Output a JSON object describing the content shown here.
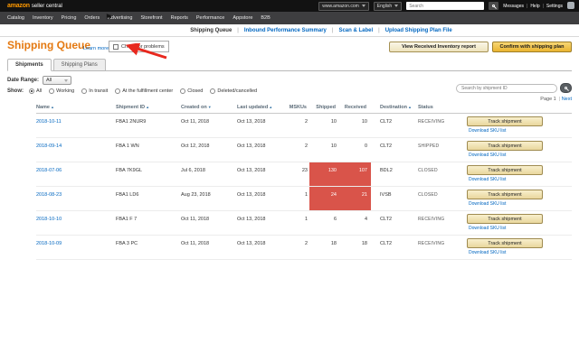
{
  "colors": {
    "title": "#e47911",
    "link": "#0066c0",
    "highlight_cell": "#d9544a",
    "primary_button_top": "#f7d675",
    "primary_button_bottom": "#eab430",
    "annotation_arrow": "#e8281e"
  },
  "icons": {
    "topbar_search": "search-icon",
    "marketplace_caret": "chevron-down-icon",
    "language_caret": "chevron-down-icon",
    "nav_flag": "flag-icon",
    "go_button": "search-icon"
  },
  "topbar": {
    "logo_brand": "amazon",
    "logo_suffix": "seller central",
    "marketplace": "www.amazon.com",
    "language": "English",
    "search_placeholder": "Search",
    "links": [
      "Messages",
      "Help",
      "Settings"
    ]
  },
  "navbar": {
    "items": [
      "Catalog",
      "Inventory",
      "Pricing",
      "Orders",
      "Advertising",
      "Storefront",
      "Reports",
      "Performance",
      "Appstore",
      "B2B"
    ]
  },
  "subnav": {
    "items": [
      {
        "label": "Shipping Queue",
        "active": true
      },
      {
        "label": "Inbound Performance Summary",
        "active": false
      },
      {
        "label": "Scan & Label",
        "active": false
      },
      {
        "label": "Upload Shipping Plan File",
        "active": false
      }
    ]
  },
  "header": {
    "title": "Shipping Queue",
    "learn_more": "Learn more",
    "check_label": "Check for problems",
    "view_report_button": "View Received Inventory report",
    "confirm_button": "Confirm with shipping plan"
  },
  "tabs": [
    {
      "label": "Shipments",
      "active": true
    },
    {
      "label": "Shipping Plans",
      "active": false
    }
  ],
  "filters": {
    "date_range_label": "Date Range:",
    "date_range_value": "All",
    "show_label": "Show:",
    "options": [
      {
        "label": "All",
        "selected": true
      },
      {
        "label": "Working",
        "selected": false
      },
      {
        "label": "In transit",
        "selected": false
      },
      {
        "label": "At the fulfillment center",
        "selected": false
      },
      {
        "label": "Closed",
        "selected": false
      },
      {
        "label": "Deleted/cancelled",
        "selected": false
      }
    ],
    "search_placeholder": "Search by shipment ID",
    "page_label": "Page 1",
    "next_label": "Next"
  },
  "table": {
    "columns": [
      {
        "label": "Name",
        "sort_icon": "▲"
      },
      {
        "label": "Shipment ID",
        "sort_icon": "▲"
      },
      {
        "label": "Created on",
        "sort_icon": "▼"
      },
      {
        "label": "Last updated",
        "sort_icon": "▲"
      },
      {
        "label": "MSKUs",
        "sort_icon": ""
      },
      {
        "label": "Shipped",
        "sort_icon": ""
      },
      {
        "label": "Received",
        "sort_icon": ""
      },
      {
        "label": "Destination",
        "sort_icon": "▲"
      },
      {
        "label": "Status",
        "sort_icon": ""
      }
    ],
    "track_label": "Track shipment",
    "download_label": "Download SKU list",
    "rows": [
      {
        "name": "2018-10-11",
        "id": "FBA1  2NUR9",
        "created": "Oct 11, 2018",
        "updated": "Oct 13, 2018",
        "mskus": "2",
        "shipped": "10",
        "received": "10",
        "dest": "CLT2",
        "status": "RECEIVING",
        "highlight": false
      },
      {
        "name": "2018-09-14",
        "id": "FBA  1  WN",
        "created": "Oct 12, 2018",
        "updated": "Oct 13, 2018",
        "mskus": "2",
        "shipped": "10",
        "received": "0",
        "dest": "CLT2",
        "status": "SHIPPED",
        "highlight": false
      },
      {
        "name": "2018-07-06",
        "id": "FBA  7K9GL",
        "created": "Jul 6, 2018",
        "updated": "Oct 13, 2018",
        "mskus": "23",
        "shipped": "130",
        "received": "107",
        "dest": "BDL2",
        "status": "CLOSED",
        "highlight": true
      },
      {
        "name": "2018-08-23",
        "id": "FBA1  LD6",
        "created": "Aug 23, 2018",
        "updated": "Oct 13, 2018",
        "mskus": "1",
        "shipped": "24",
        "received": "21",
        "dest": "IVSB",
        "status": "CLOSED",
        "highlight": true
      },
      {
        "name": "2018-10-10",
        "id": "FBA1  F  7",
        "created": "Oct 11, 2018",
        "updated": "Oct 13, 2018",
        "mskus": "1",
        "shipped": "6",
        "received": "4",
        "dest": "CLT2",
        "status": "RECEIVING",
        "highlight": false
      },
      {
        "name": "2018-10-09",
        "id": "FBA  3  PC",
        "created": "Oct 11, 2018",
        "updated": "Oct 13, 2018",
        "mskus": "2",
        "shipped": "18",
        "received": "18",
        "dest": "CLT2",
        "status": "RECEIVING",
        "highlight": false
      }
    ]
  }
}
